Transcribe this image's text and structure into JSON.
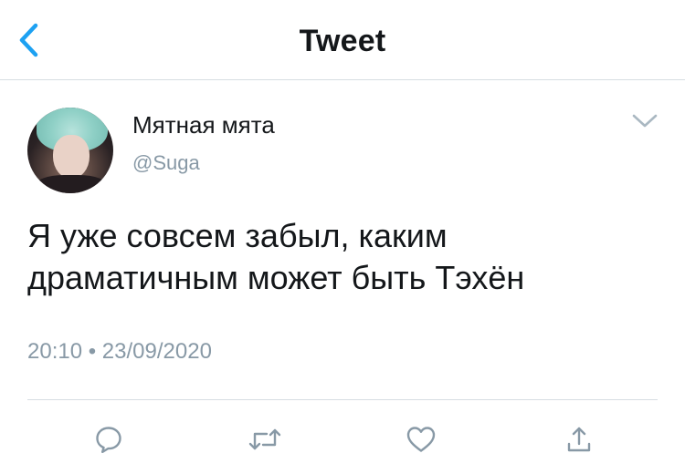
{
  "header": {
    "title": "Tweet",
    "back_icon": "chevron-left-icon",
    "accent_color": "#1da1f2"
  },
  "tweet": {
    "author": {
      "display_name": "Мятная мята",
      "handle": "@Suga"
    },
    "text_lines": [
      "Я уже совсем забыл, каким",
      "драматичным может быть Тэхён"
    ],
    "timestamp": "20:10 • 23/09/2020",
    "more_icon": "chevron-down-icon"
  },
  "actions": [
    {
      "name": "reply",
      "icon": "reply-icon"
    },
    {
      "name": "retweet",
      "icon": "retweet-icon"
    },
    {
      "name": "like",
      "icon": "heart-icon"
    },
    {
      "name": "share",
      "icon": "share-icon"
    }
  ],
  "colors": {
    "text": "#14171a",
    "muted": "#8899a6",
    "divider": "#d7dde2"
  }
}
